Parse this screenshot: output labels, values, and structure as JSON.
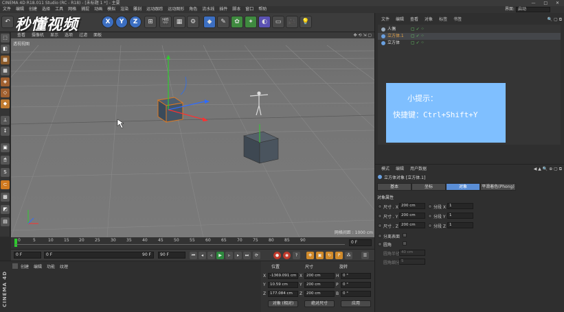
{
  "window": {
    "title": "CINEMA 4D R18.011 Studio (RC - R18) - [未标题 1 *] - 主要",
    "controls": "— □ ✕",
    "layout_label": "界面:",
    "layout_value": "启动"
  },
  "watermark": "秒懂视频",
  "menubar": [
    "文件",
    "编辑",
    "创建",
    "选择",
    "工具",
    "网格",
    "捕捉",
    "动画",
    "模拟",
    "渲染",
    "雕刻",
    "运动跟踪",
    "运动图形",
    "角色",
    "流水线",
    "插件",
    "脚本",
    "窗口",
    "帮助"
  ],
  "toolbar": {
    "axis_x": "X",
    "axis_y": "Y",
    "axis_z": "Z"
  },
  "viewport": {
    "menu": [
      "查看",
      "摄像机",
      "显示",
      "选项",
      "过滤",
      "面板"
    ],
    "label": "透视视图",
    "grid_info": "网格间距 : 1000 cm"
  },
  "timeline": {
    "ticks": [
      "0",
      "5",
      "10",
      "15",
      "20",
      "25",
      "30",
      "35",
      "40",
      "45",
      "50",
      "55",
      "60",
      "65",
      "70",
      "75",
      "80",
      "85",
      "90"
    ],
    "end_field": "0 F"
  },
  "playbar": {
    "current": "0 F",
    "min": "0 F",
    "max": "90 F",
    "end": "90 F"
  },
  "material_panel": {
    "menu": [
      "创建",
      "编辑",
      "功能",
      "纹理"
    ],
    "brand": "CINEMA 4D"
  },
  "coords": {
    "headers": {
      "position": "位置",
      "size": "尺寸",
      "rotation": "旋转"
    },
    "rows": [
      {
        "axis": "X",
        "pos": "-1369.091 cm",
        "size_axis": "X",
        "size": "200 cm",
        "rot_axis": "H",
        "rot": "0 °"
      },
      {
        "axis": "Y",
        "pos": "10.59 cm",
        "size_axis": "Y",
        "size": "200 cm",
        "rot_axis": "P",
        "rot": "0 °"
      },
      {
        "axis": "Z",
        "pos": "177.084 cm",
        "size_axis": "Z",
        "size": "200 cm",
        "rot_axis": "B",
        "rot": "0 °"
      }
    ],
    "mode_object": "对象 (相对)",
    "mode_size": "绝对尺寸",
    "apply": "应用"
  },
  "object_manager": {
    "menu": [
      "文件",
      "编辑",
      "查看",
      "对象",
      "标签",
      "书签"
    ],
    "items": [
      {
        "name": "人偶",
        "selected": false
      },
      {
        "name": "立方体.1",
        "selected": true
      },
      {
        "name": "立方体",
        "selected": false
      }
    ]
  },
  "tip": {
    "title": "小提示：",
    "body": "快捷键：Ctrl+Shift+Y"
  },
  "attributes": {
    "menu": [
      "模式",
      "编辑",
      "用户数据"
    ],
    "title": "立方体对象 [立方体.1]",
    "tabs": [
      {
        "label": "基本",
        "active": false
      },
      {
        "label": "坐标",
        "active": false
      },
      {
        "label": "对象",
        "active": true
      },
      {
        "label": "平滑着色(Phong)",
        "active": false
      }
    ],
    "section": "对象属性",
    "size_rows": [
      {
        "label": "尺寸 . X",
        "value": "200 cm",
        "seg_label": "分段 X",
        "seg": "1"
      },
      {
        "label": "尺寸 . Y",
        "value": "200 cm",
        "seg_label": "分段 Y",
        "seg": "1"
      },
      {
        "label": "尺寸 . Z",
        "value": "200 cm",
        "seg_label": "分段 Z",
        "seg": "1"
      }
    ],
    "separate_surfaces": "分离表面",
    "fillet": "圆角",
    "fillet_radius_label": "圆角半径",
    "fillet_radius": "40 cm",
    "fillet_subdiv_label": "圆角细分",
    "fillet_subdiv": "5"
  },
  "colors": {
    "accent_blue": "#5a8ed6",
    "selection_orange": "#e9a646",
    "tip_bg": "#7fbfff",
    "viewport": "#757575"
  }
}
